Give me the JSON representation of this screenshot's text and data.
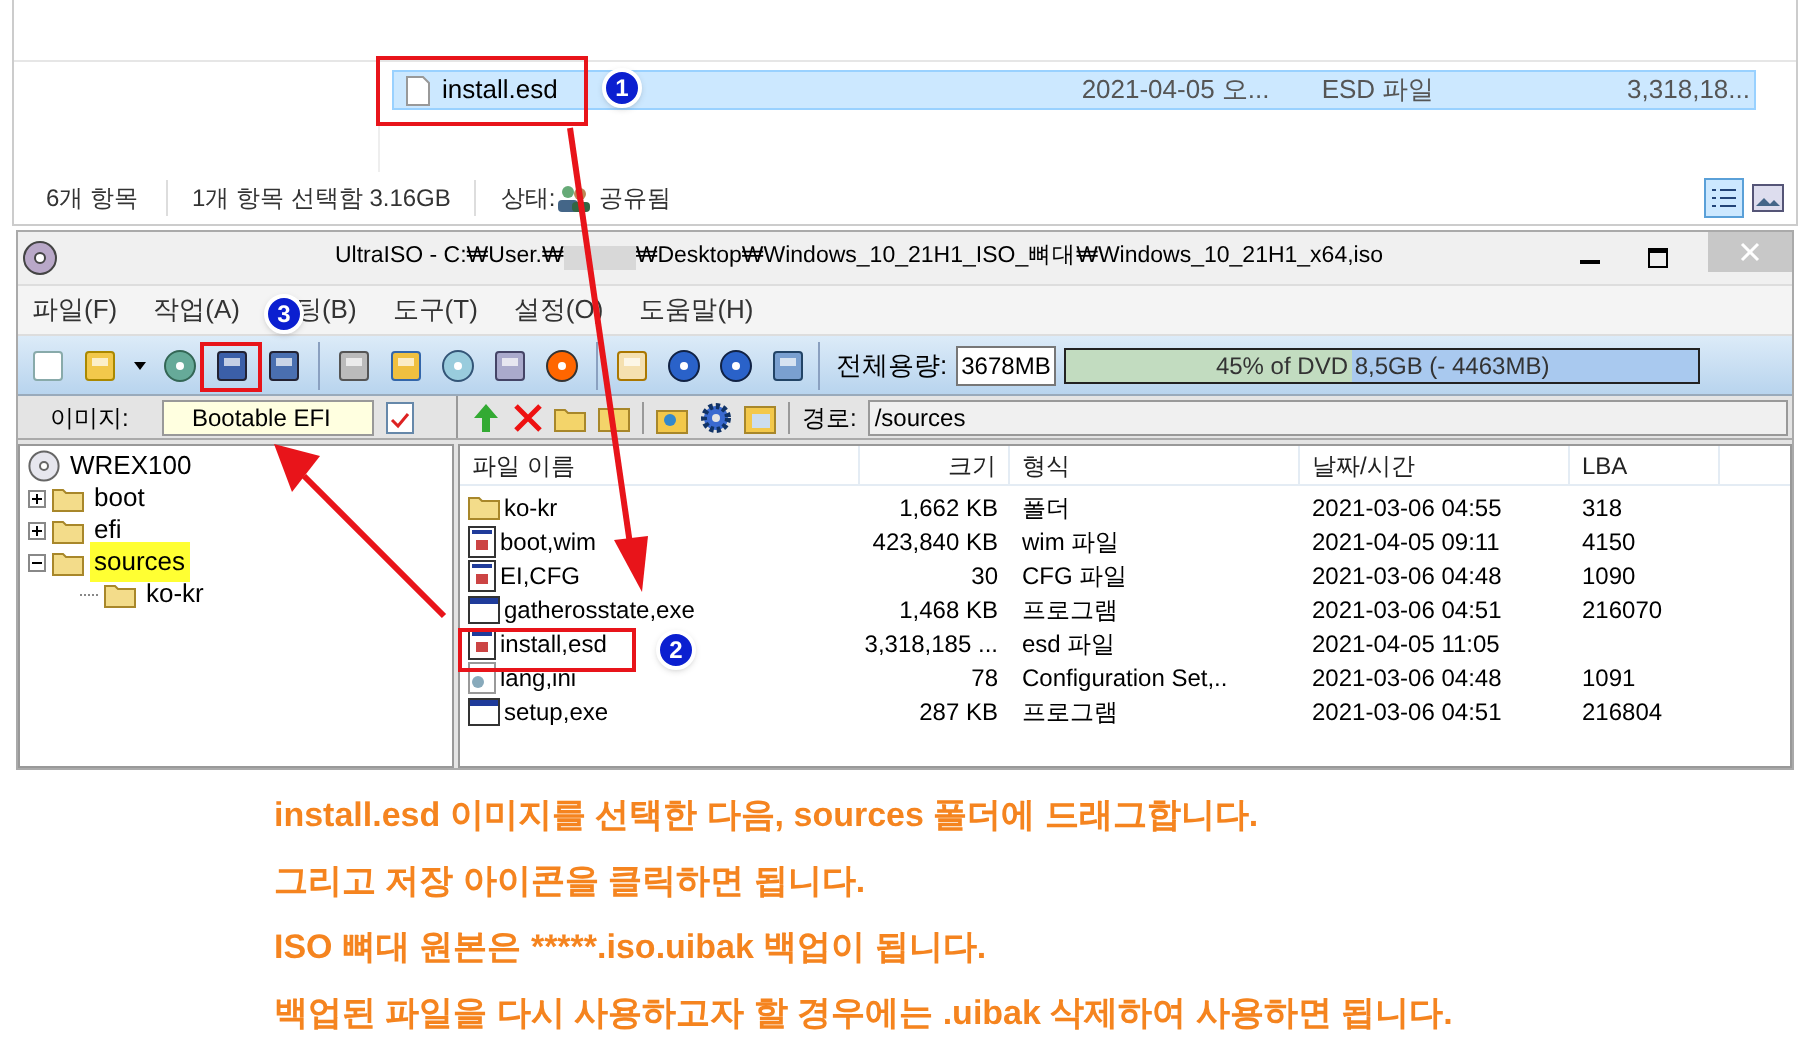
{
  "explorer": {
    "selected_file": {
      "name": "install.esd",
      "date": "2021-04-05 오...",
      "type": "ESD 파일",
      "size": "3,318,18...",
      "selected": true
    },
    "status_bar": {
      "item_count": "6개 항목",
      "selection": "1개 항목 선택함 3.16GB",
      "state_label": "상태:",
      "state_value": "공유됨"
    }
  },
  "window": {
    "title_start": "UltraISO - C:₩User.₩",
    "title_end": "₩Desktop₩Windows_10_21H1_ISO_뼈대₩Windows_10_21H1_x64,iso"
  },
  "menu": [
    "파일(F)",
    "작업(A)",
    "팅(B)",
    "도구(T)",
    "설정(O)",
    "도움말(H)"
  ],
  "capacity": {
    "label": "전체용량:",
    "value": "3678MB",
    "level": 0.45,
    "reading": "45% of DVD 8,5GB (- 4463MB)"
  },
  "image_bar": {
    "label": "이미지:",
    "value": "Bootable EFI"
  },
  "path_bar": {
    "label": "경로:",
    "value": "/sources"
  },
  "tree": [
    {
      "label": "WREX100",
      "kind": "disc",
      "selected": false,
      "children": [
        {
          "label": "boot",
          "kind": "folder",
          "expanded": false,
          "selected": false
        },
        {
          "label": "efi",
          "kind": "folder",
          "expanded": false,
          "selected": false
        },
        {
          "label": "sources",
          "kind": "folder",
          "expanded": true,
          "selected": true,
          "children": [
            {
              "label": "ko-kr",
              "kind": "folder",
              "selected": false
            }
          ]
        }
      ]
    }
  ],
  "table": {
    "columns": [
      "파일 이름",
      "크기",
      "형식",
      "날짜/시간",
      "LBA"
    ],
    "rows": [
      {
        "kind": "folder",
        "cells": [
          "ko-kr",
          "1,662 KB",
          "폴더",
          "2021-03-06 04:55",
          "318"
        ]
      },
      {
        "kind": "file",
        "cells": [
          "boot,wim",
          "423,840 KB",
          "wim 파일",
          "2021-04-05 09:11",
          "4150"
        ]
      },
      {
        "kind": "file",
        "cells": [
          "EI,CFG",
          "30",
          "CFG 파일",
          "2021-03-06 04:48",
          "1090"
        ]
      },
      {
        "kind": "program",
        "cells": [
          "gatherosstate,exe",
          "1,468 KB",
          "프로그램",
          "2021-03-06 04:51",
          "216070"
        ]
      },
      {
        "kind": "file",
        "cells": [
          "install,esd",
          "3,318,185 ...",
          "esd 파일",
          "2021-04-05 11:05",
          ""
        ]
      },
      {
        "kind": "settings",
        "cells": [
          "lang,ini",
          "78",
          "Configuration Set,..",
          "2021-03-06 04:48",
          "1091"
        ]
      },
      {
        "kind": "program",
        "cells": [
          "setup,exe",
          "287 KB",
          "프로그램",
          "2021-03-06 04:51",
          "216804"
        ]
      }
    ]
  },
  "steps": [
    "1",
    "2",
    "3"
  ],
  "instructions": [
    "install.esd 이미지를 선택한 다음, sources 폴더에 드래그합니다.",
    "그리고 저장 아이콘을 클릭하면 됩니다.",
    "ISO 뼈대 원본은 *****.iso.uibak 백업이 됩니다.",
    "백업된 파일을 다시 사용하고자 할 경우에는 .uibak 삭제하여 사용하면 됩니다."
  ]
}
